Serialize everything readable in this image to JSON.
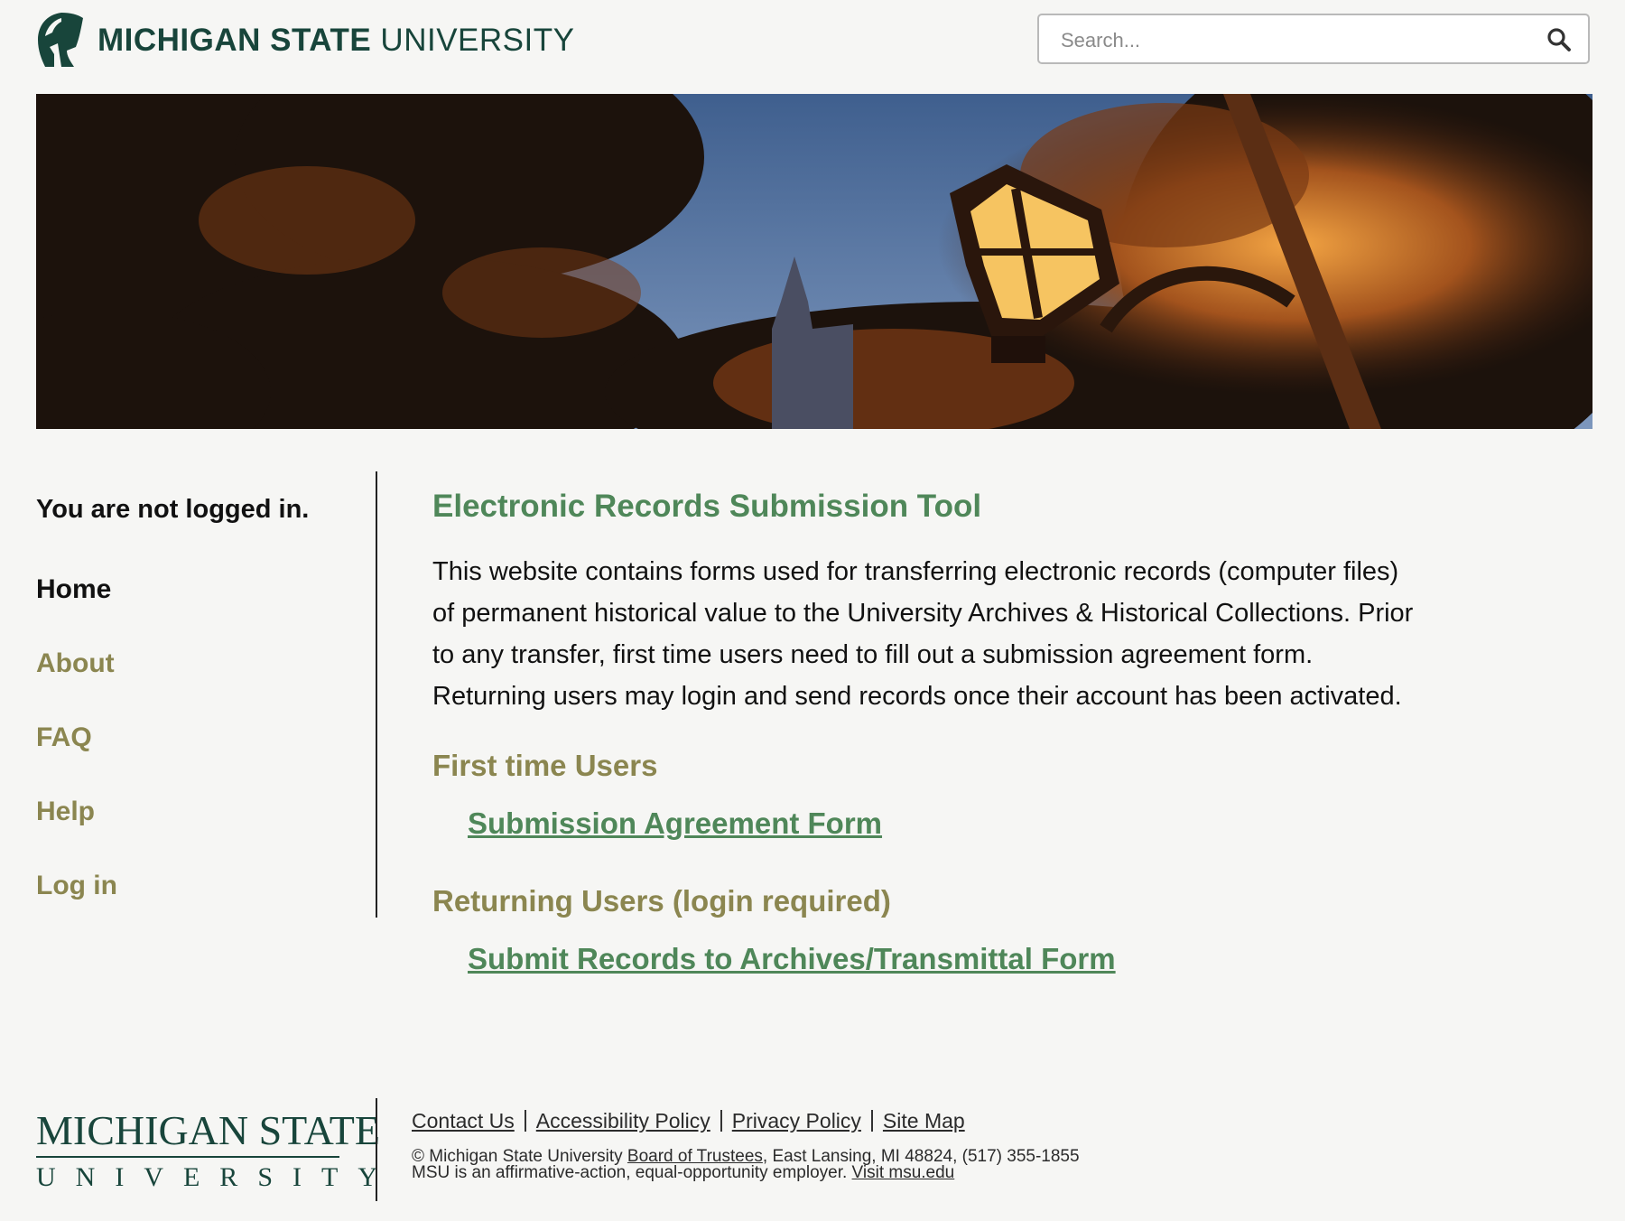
{
  "header": {
    "logo_bold": "MICHIGAN STATE",
    "logo_light": "UNIVERSITY",
    "search_placeholder": "Search...",
    "search_icon": "magnifier-icon",
    "helmet_icon": "spartan-helmet-icon"
  },
  "hero": {
    "image": "campus-lantern-night-photo"
  },
  "sidebar": {
    "login_status": "You are not logged in.",
    "nav": [
      {
        "label": "Home",
        "active": true
      },
      {
        "label": "About",
        "active": false
      },
      {
        "label": "FAQ",
        "active": false
      },
      {
        "label": "Help",
        "active": false
      },
      {
        "label": "Log in",
        "active": false
      }
    ]
  },
  "main": {
    "title": "Electronic Records Submission Tool",
    "intro_lines": [
      "This website contains forms used for transferring electronic records (computer files)",
      "of permanent historical value to the University Archives & Historical Collections. Prior",
      "to any transfer, first time users need to fill out a submission agreement form.",
      "Returning users may login and send records once their account has been activated."
    ],
    "first_time_heading": "First time Users",
    "first_time_link": "Submission Agreement Form",
    "returning_heading": "Returning Users (login required)",
    "returning_link": "Submit Records to Archives/Transmittal Form"
  },
  "footer": {
    "logo_line1": "MICHIGAN STATE",
    "logo_line2": "UNIVERSITY",
    "links": [
      "Contact Us",
      "Accessibility Policy",
      "Privacy Policy",
      "Site Map"
    ],
    "copyright_prefix": "© Michigan State University ",
    "trustees_link": "Board of Trustees",
    "copyright_suffix": ", East Lansing, MI 48824, (517) 355-1855",
    "eeo_text": "MSU is an affirmative-action, equal-opportunity employer. ",
    "visit_link": "Visit msu.edu"
  },
  "colors": {
    "msu_green": "#18453b",
    "heading_green": "#4f8759",
    "olive": "#8b8650",
    "background": "#f6f6f4"
  }
}
